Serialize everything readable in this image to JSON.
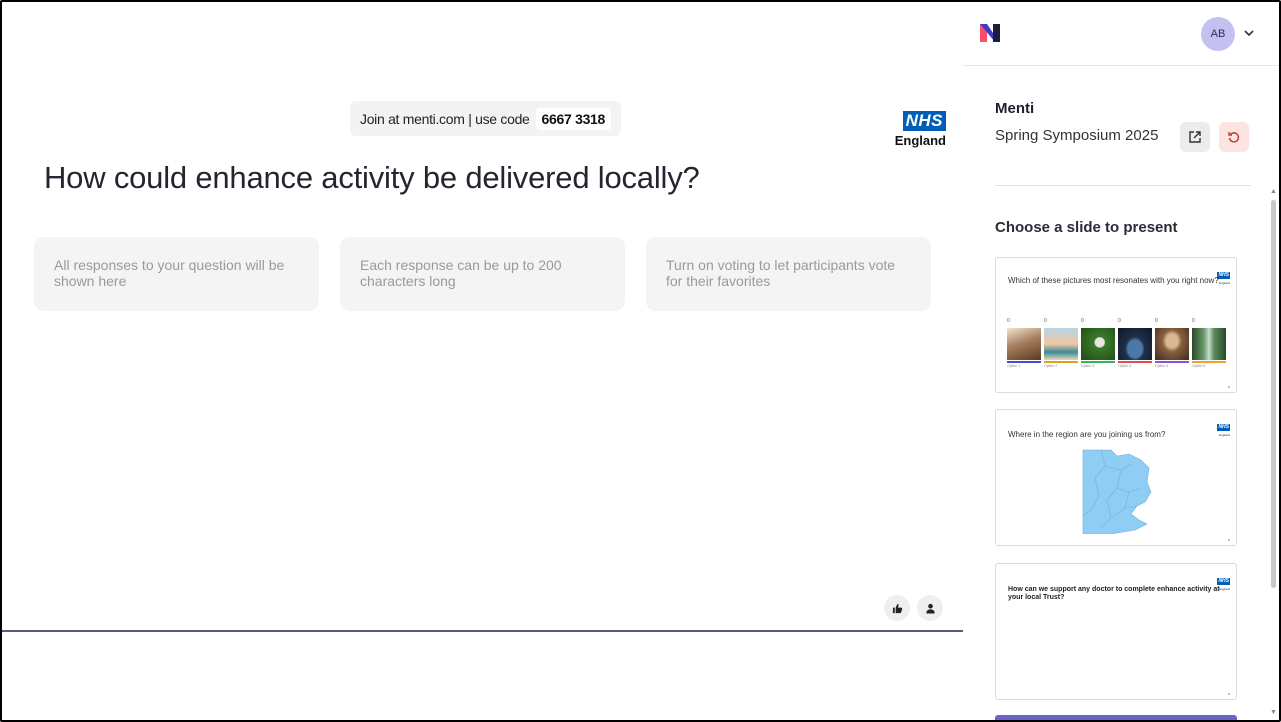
{
  "stage": {
    "join_text": "Join at menti.com | use code",
    "join_code": "6667 3318",
    "brand_box": "NHS",
    "brand_sub": "England",
    "question": "How could enhance activity be delivered locally?",
    "cards": [
      "All responses to your question will be shown here",
      "Each response can be up to 200 characters long",
      "Turn on voting to let participants vote for their favorites"
    ],
    "icons": [
      "thumbs-up-icon",
      "person-icon"
    ]
  },
  "sidebar": {
    "avatar_initials": "AB",
    "app_title": "Menti",
    "presentation_name": "Spring Symposium 2025",
    "choose_label": "Choose a slide to present",
    "slides": [
      {
        "question": "Which of these pictures most resonates with you right now?",
        "counts": [
          "0",
          "0",
          "0",
          "0",
          "0",
          "0"
        ],
        "options": [
          "Option 1",
          "Option 2",
          "Option 3",
          "Option 4",
          "Option 5",
          "Option 6"
        ],
        "colors": [
          "#8a6a4a",
          "#d9a070",
          "#4a7a3a",
          "#2a4a6a",
          "#9a7050",
          "#5a7a5a"
        ],
        "bar_colors": [
          "#4a4ad0",
          "#e0a020",
          "#40b060",
          "#e05050",
          "#9050d0",
          "#f0a030"
        ],
        "corner": "a"
      },
      {
        "question": "Where in the region are you joining us from?",
        "map_color": "#90cdf4",
        "corner": "a"
      },
      {
        "question": "How can we support any doctor to complete enhance activity at your local Trust?",
        "corner": "a"
      }
    ]
  },
  "colors": {
    "nhs_blue": "#005eb8",
    "avatar": "#c4c0f2",
    "reset_bg": "#fbe4e2",
    "accent": "#6c63c9"
  }
}
